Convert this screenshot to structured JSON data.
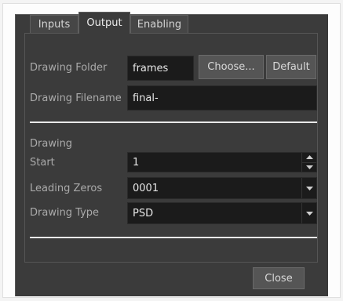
{
  "tabs": [
    {
      "label": "Inputs"
    },
    {
      "label": "Output",
      "active": true
    },
    {
      "label": "Enabling"
    }
  ],
  "output": {
    "drawing_folder_label": "Drawing Folder",
    "drawing_folder_value": "frames",
    "choose_label": "Choose...",
    "default_label": "Default",
    "drawing_filename_label": "Drawing Filename",
    "drawing_filename_value": "final-"
  },
  "drawing": {
    "section_label": "Drawing",
    "start_label": "Start",
    "start_value": "1",
    "leading_zeros_label": "Leading Zeros",
    "leading_zeros_value": "0001",
    "drawing_type_label": "Drawing Type",
    "drawing_type_value": "PSD"
  },
  "footer": {
    "close_label": "Close"
  },
  "icons": {
    "spin_up": "spin-up-icon",
    "spin_down": "spin-down-icon",
    "dropdown": "chevron-down-icon"
  }
}
